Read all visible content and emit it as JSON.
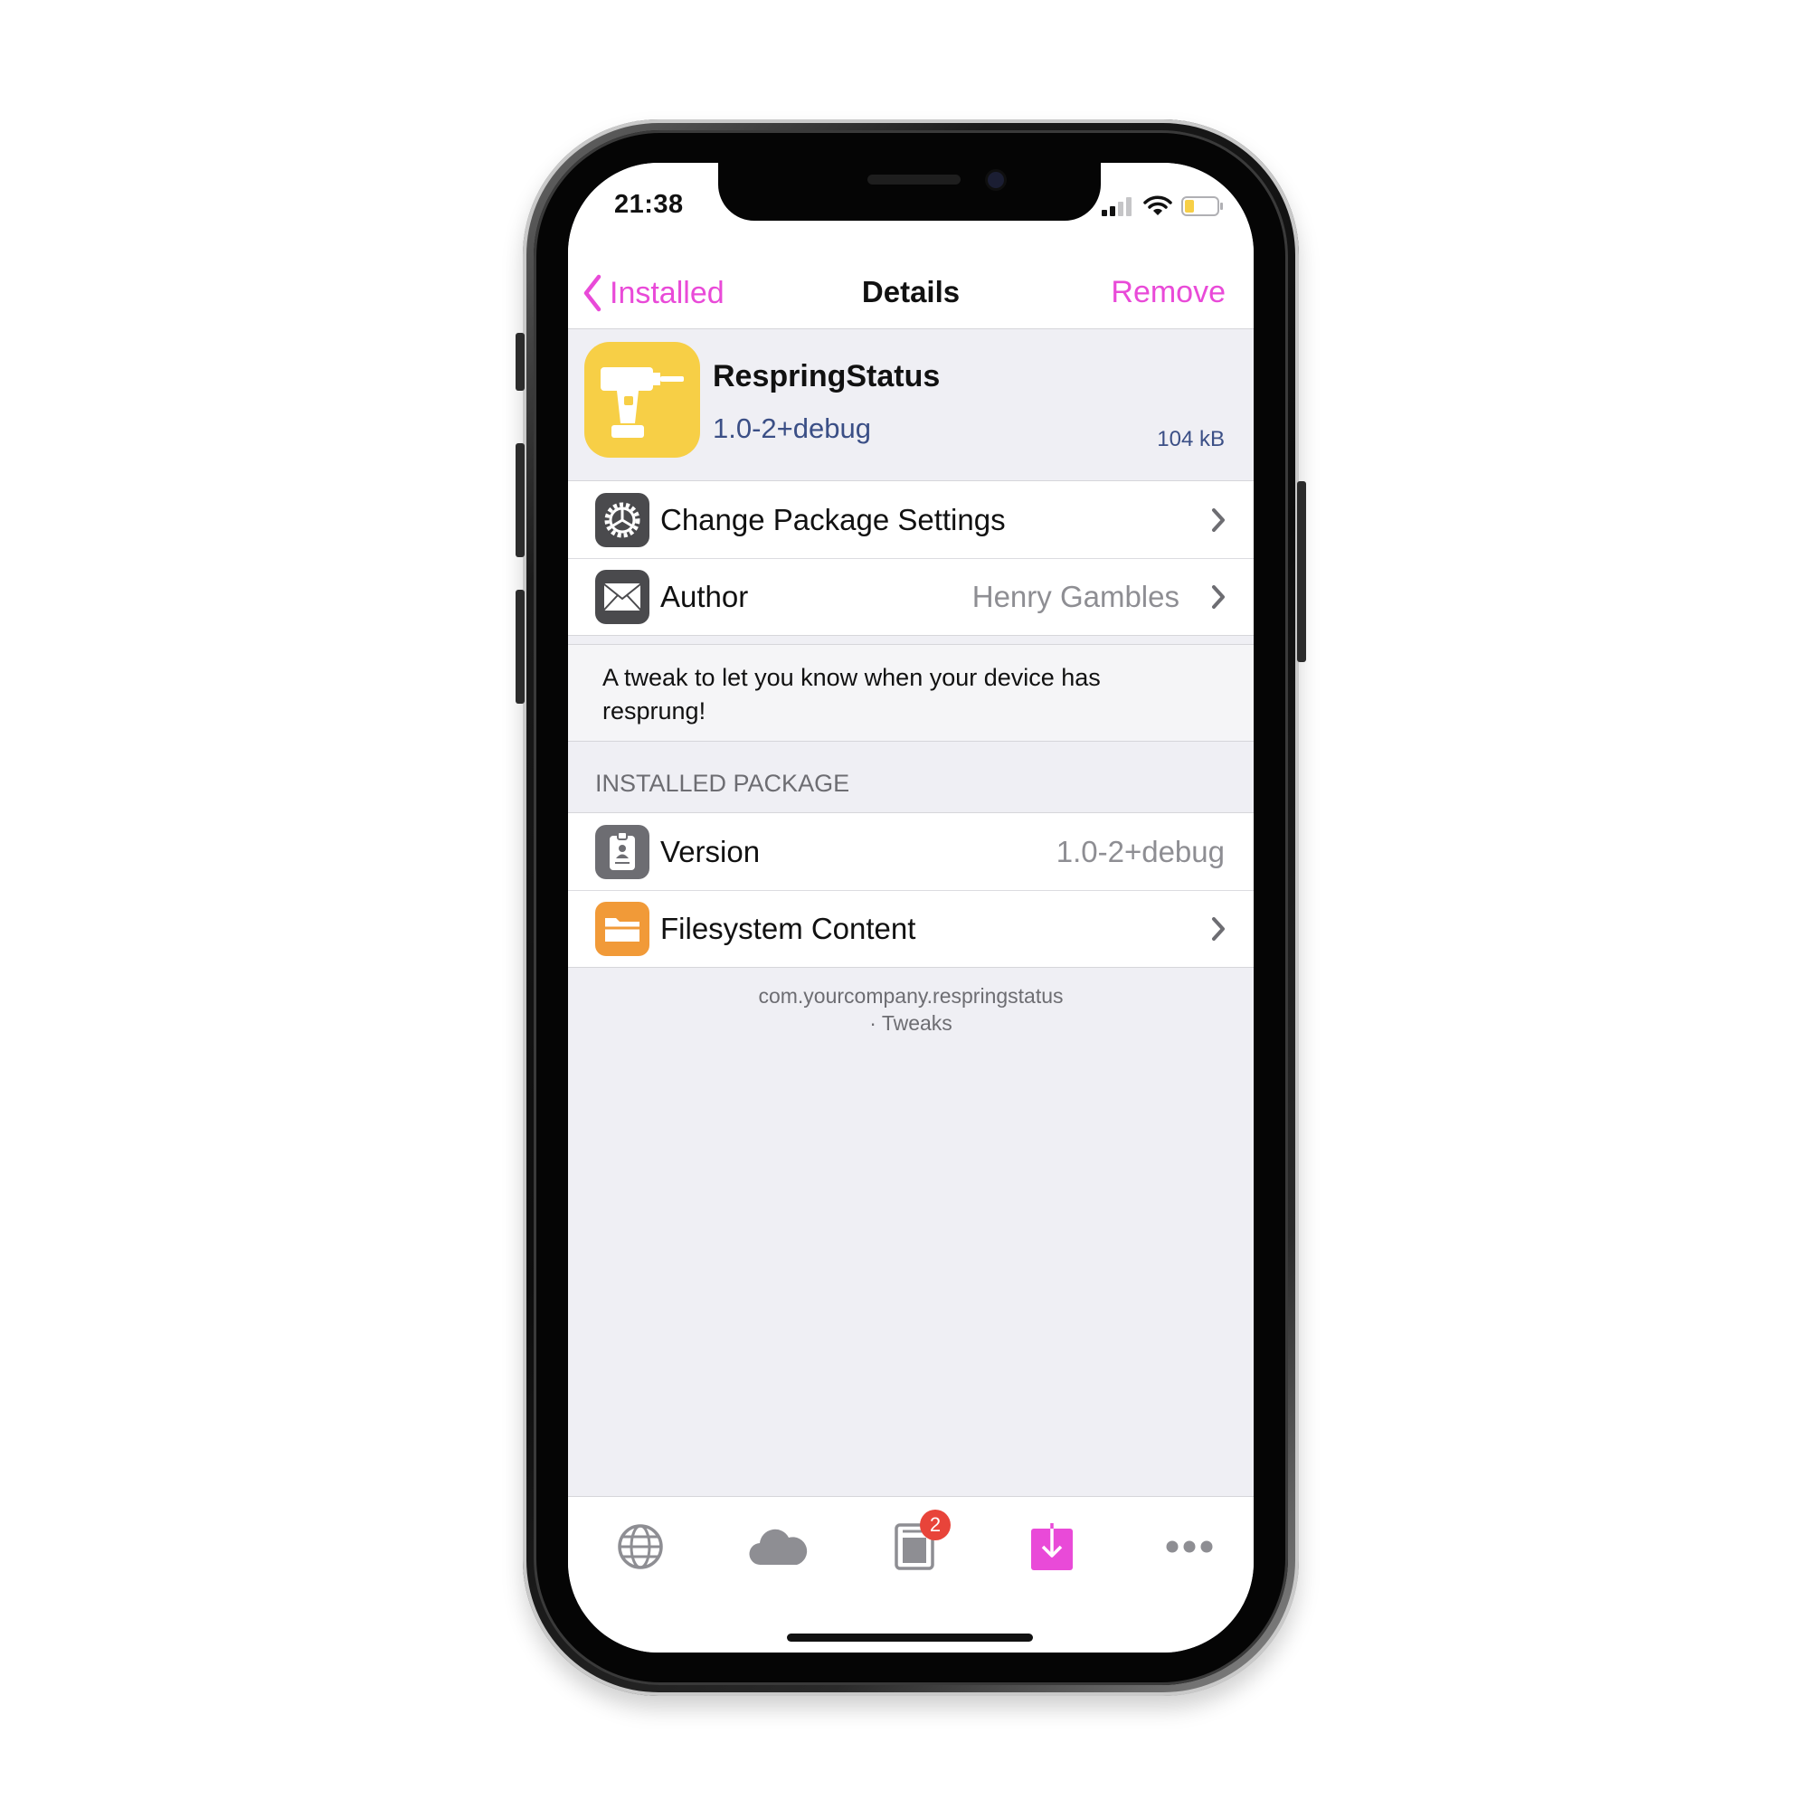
{
  "status": {
    "time": "21:38"
  },
  "nav": {
    "back_label": "Installed",
    "title": "Details",
    "remove_label": "Remove"
  },
  "package": {
    "name": "RespringStatus",
    "version": "1.0-2+debug",
    "size": "104 kB"
  },
  "actions": [
    {
      "label": "Change Package Settings",
      "icon": "gear-icon"
    },
    {
      "label": "Author",
      "value": "Henry Gambles",
      "icon": "mail-icon"
    }
  ],
  "description": "A tweak to let you know when your device has resprung!",
  "installed_section": {
    "header": "INSTALLED PACKAGE",
    "rows": [
      {
        "label": "Version",
        "value": "1.0-2+debug",
        "icon": "badge-icon"
      },
      {
        "label": "Filesystem Content",
        "icon": "folder-icon"
      }
    ]
  },
  "footer": {
    "identifier": "com.yourcompany.respringstatus",
    "section": "· Tweaks"
  },
  "tabbar": {
    "items": [
      "globe-icon",
      "cloud-icon",
      "changes-icon",
      "installed-icon",
      "more-icon"
    ],
    "badge": "2",
    "active": "installed-icon"
  },
  "colors": {
    "accent": "#e94ad8",
    "version_text": "#3b4f86",
    "app_icon": "#f7cf46",
    "badge": "#e8443a",
    "folder": "#f19a38"
  }
}
